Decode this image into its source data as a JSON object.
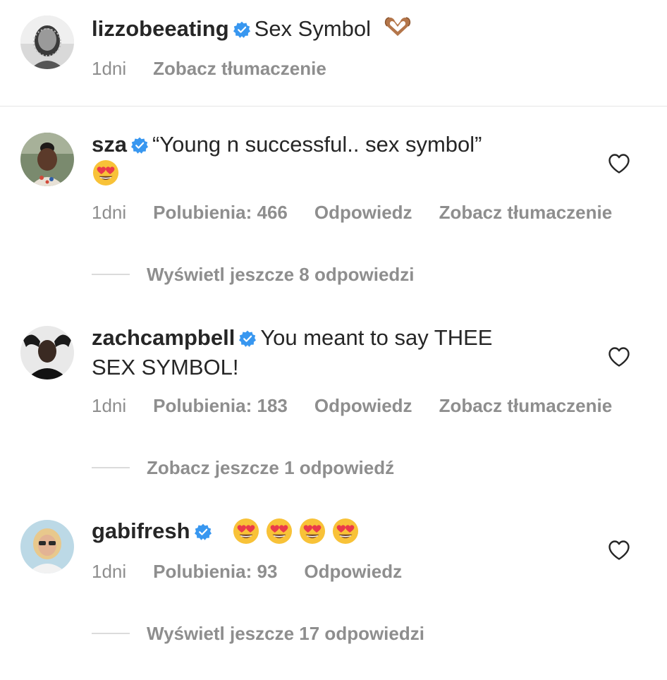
{
  "caption": {
    "username": "lizzobeeating",
    "text": "Sex Symbol",
    "time": "1dni",
    "translate": "Zobacz tłumaczenie"
  },
  "comments": [
    {
      "username": "sza",
      "text": "“Young n successful.. sex symbol”",
      "time": "1dni",
      "likes": "Polubienia: 466",
      "reply": "Odpowiedz",
      "translate": "Zobacz tłumaczenie",
      "replies": "Wyświetl jeszcze 8 odpowiedzi"
    },
    {
      "username": "zachcampbell",
      "text": "You meant to say THEE",
      "text2": "SEX SYMBOL!",
      "time": "1dni",
      "likes": "Polubienia: 183",
      "reply": "Odpowiedz",
      "translate": "Zobacz tłumaczenie",
      "replies": "Zobacz jeszcze 1 odpowiedź"
    },
    {
      "username": "gabifresh",
      "time": "1dni",
      "likes": "Polubienia: 93",
      "reply": "Odpowiedz",
      "replies": "Wyświetl jeszcze 17 odpowiedzi"
    }
  ],
  "colors": {
    "text": "#262626",
    "secondary": "#8e8e8e",
    "verified": "#3897f0",
    "divider": "#e6e6e6"
  },
  "icons": [
    "verified-badge-icon",
    "heart-hands-emoji",
    "heart-eyes-emoji",
    "heart-outline-icon"
  ]
}
